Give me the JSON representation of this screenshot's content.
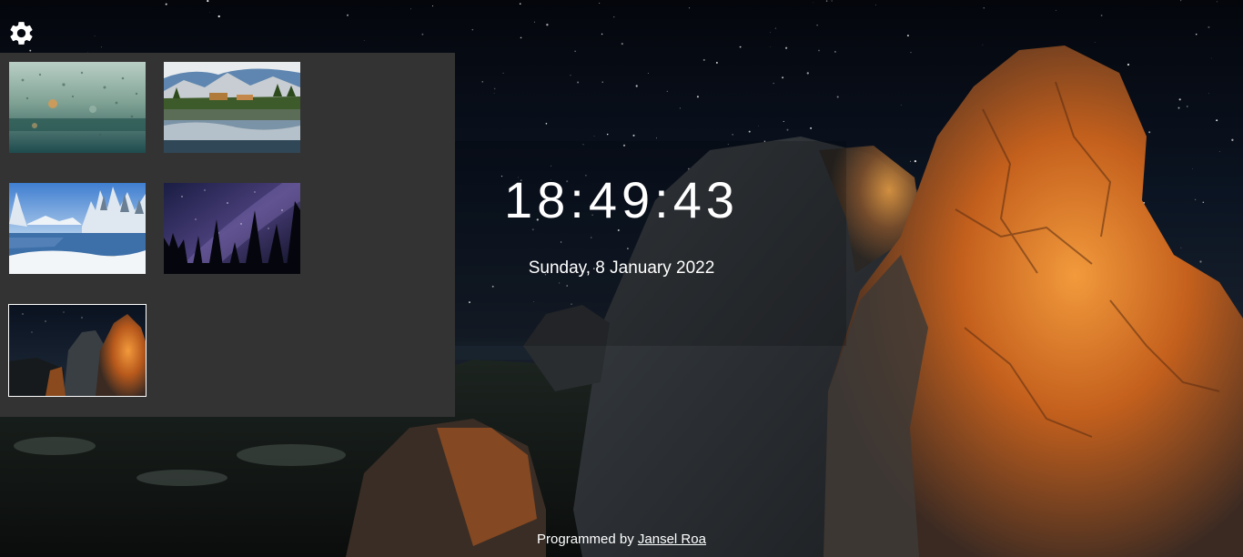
{
  "settings": {
    "icon": "gear-icon"
  },
  "wallpapers": {
    "items": [
      {
        "name": "rain-on-glass",
        "selected": false
      },
      {
        "name": "mountain-lake-reflection",
        "selected": false
      },
      {
        "name": "snowy-lake",
        "selected": false
      },
      {
        "name": "milky-way-forest",
        "selected": false
      },
      {
        "name": "glowing-rocks-night",
        "selected": true
      }
    ]
  },
  "clock": {
    "time": "18:49:43",
    "date": "Sunday, 8 January 2022"
  },
  "footer": {
    "prefix": "Programmed by ",
    "author": "Jansel Roa"
  },
  "colors": {
    "panel_bg": "#333333",
    "text": "#ffffff",
    "rock_orange": "#d9782a"
  }
}
